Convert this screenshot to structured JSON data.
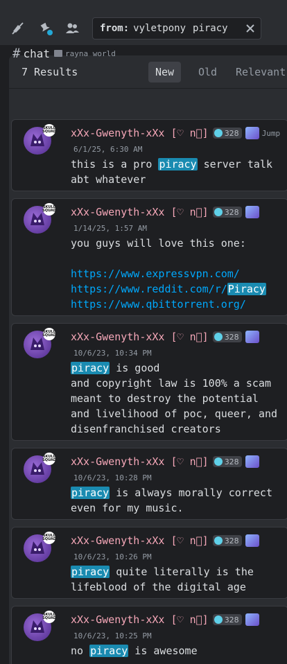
{
  "search": {
    "from_label": "from:",
    "from_value": "vyletpony",
    "query": "piracy"
  },
  "results": {
    "count_label": "7 Results",
    "sort_tabs": [
      {
        "label": "New",
        "active": true
      },
      {
        "label": "Old",
        "active": false
      },
      {
        "label": "Relevant",
        "active": false
      }
    ]
  },
  "channel": {
    "hash": "#",
    "name": "chat",
    "server": "rayna world"
  },
  "user": {
    "name": "xXx-Gwenyth-xXx [♡ n⃝]",
    "tag": "328",
    "avatar_badge": "SKULL SQUAD"
  },
  "jump_label": "Jump",
  "messages": [
    {
      "time": "6/1/25, 6:30 AM",
      "parts": [
        [
          "this is a pro ",
          ""
        ],
        [
          "piracy",
          "hl"
        ],
        [
          " server talk abt whatever",
          ""
        ]
      ]
    },
    {
      "time": "1/14/25, 1:57 AM",
      "parts": [
        [
          "you guys will love this one:\n\n",
          ""
        ],
        [
          "https://www.expressvpn.com/\nhttps://www.reddit.com/r/",
          "link"
        ],
        [
          "Piracy",
          "hl"
        ],
        [
          "\nhttps://www.qbittorrent.org/",
          "link"
        ]
      ]
    },
    {
      "time": "10/6/23, 10:34 PM",
      "parts": [
        [
          "piracy",
          "hl"
        ],
        [
          " is good\nand copyright law is 100% a scam meant to destroy the potential and livelihood of poc, queer, and disenfranchised creators",
          ""
        ]
      ]
    },
    {
      "time": "10/6/23, 10:28 PM",
      "parts": [
        [
          "piracy",
          "hl"
        ],
        [
          " is always morally correct even for my music.",
          ""
        ]
      ]
    },
    {
      "time": "10/6/23, 10:26 PM",
      "parts": [
        [
          "piracy",
          "hl"
        ],
        [
          " quite literally is the lifeblood of the digital age",
          ""
        ]
      ]
    },
    {
      "time": "10/6/23, 10:25 PM",
      "parts": [
        [
          "no ",
          ""
        ],
        [
          "piracy",
          "hl"
        ],
        [
          " is awesome",
          ""
        ]
      ]
    }
  ]
}
